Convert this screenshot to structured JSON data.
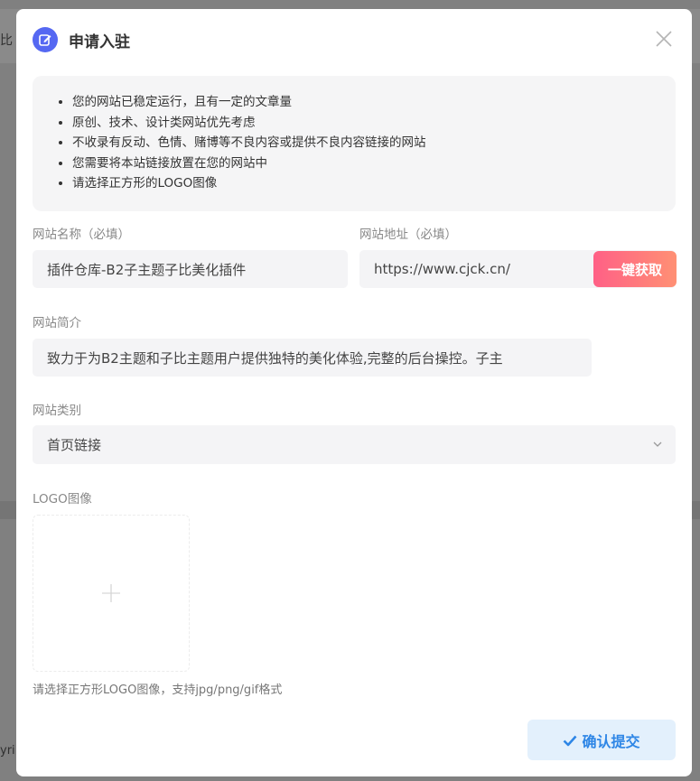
{
  "background": {
    "left_text_top": "比",
    "left_text_bottom": "yri"
  },
  "dialog": {
    "title": "申请入驻",
    "notice_items": [
      "您的网站已稳定运行，且有一定的文章量",
      "原创、技术、设计类网站优先考虑",
      "不收录有反动、色情、赌博等不良内容或提供不良内容链接的网站",
      "您需要将本站链接放置在您的网站中",
      "请选择正方形的LOGO图像"
    ],
    "site_name": {
      "label": "网站名称（必填）",
      "value": "插件仓库-B2子主题子比美化插件"
    },
    "site_url": {
      "label": "网站地址（必填）",
      "value": "https://www.cjck.cn/",
      "fetch_button": "一键获取"
    },
    "site_desc": {
      "label": "网站简介",
      "value": "致力于为B2主题和子比主题用户提供独特的美化体验,完整的后台操控。子主"
    },
    "site_category": {
      "label": "网站类别",
      "selected": "首页链接"
    },
    "logo": {
      "label": "LOGO图像",
      "hint": "请选择正方形LOGO图像，支持jpg/png/gif格式"
    },
    "submit_button": "确认提交"
  },
  "colors": {
    "accent": "#5568f2",
    "fetch_gradient_start": "#ff6086",
    "fetch_gradient_end": "#ff9074",
    "submit_text": "#2e86e6",
    "submit_bg": "#e3f0fc"
  }
}
